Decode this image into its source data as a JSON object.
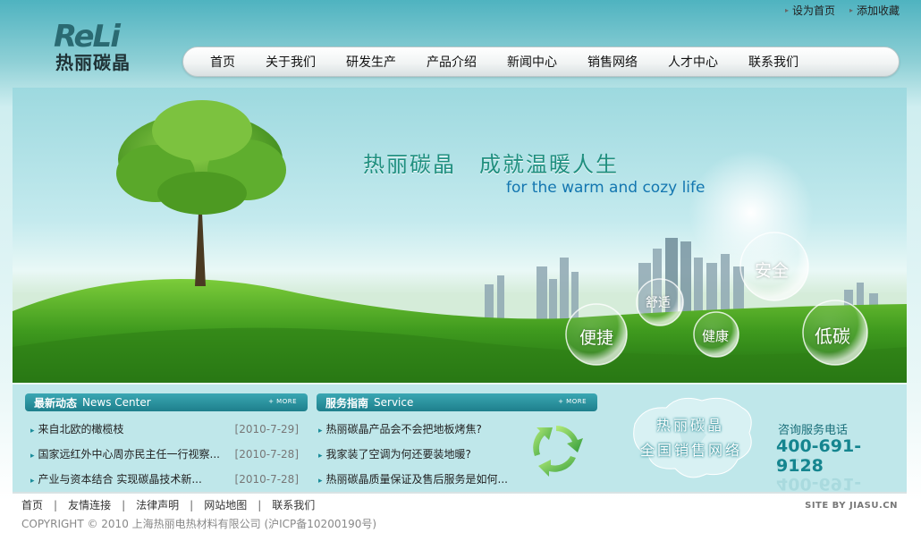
{
  "top_links": [
    {
      "label": "设为首页"
    },
    {
      "label": "添加收藏"
    }
  ],
  "logo": {
    "en": "ReLi",
    "cn": "热丽碳晶"
  },
  "nav": {
    "items": [
      {
        "label": "首页"
      },
      {
        "label": "关于我们"
      },
      {
        "label": "研发生产"
      },
      {
        "label": "产品介绍"
      },
      {
        "label": "新闻中心"
      },
      {
        "label": "销售网络"
      },
      {
        "label": "人才中心"
      },
      {
        "label": "联系我们"
      }
    ]
  },
  "banner": {
    "slogan_cn": "热丽碳晶　成就温暖人生",
    "slogan_en": "for the warm and cozy life",
    "bubbles": [
      "安全",
      "舒适",
      "便捷",
      "健康",
      "低碳"
    ]
  },
  "news": {
    "title_cn": "最新动态",
    "title_en": "News Center",
    "more": "+ MORE",
    "items": [
      {
        "title": "来自北欧的橄榄枝",
        "date": "[2010-7-29]"
      },
      {
        "title": "国家远红外中心周亦民主任一行视察...",
        "date": "[2010-7-28]"
      },
      {
        "title": "产业与资本结合 实现碳晶技术新...",
        "date": "[2010-7-28]"
      }
    ]
  },
  "service": {
    "title_cn": "服务指南",
    "title_en": "Service",
    "more": "+ MORE",
    "items": [
      {
        "title": "热丽碳晶产品会不会把地板烤焦?"
      },
      {
        "title": "我家装了空调为何还要装地暖?"
      },
      {
        "title": "热丽碳晶质量保证及售后服务是如何..."
      }
    ]
  },
  "network": {
    "line1": "热丽碳晶",
    "line2": "全国销售网络"
  },
  "hotline": {
    "label": "咨询服务电话",
    "number": "400-691-9128"
  },
  "footer": {
    "links": [
      {
        "label": "首页"
      },
      {
        "label": "友情连接"
      },
      {
        "label": "法律声明"
      },
      {
        "label": "网站地图"
      },
      {
        "label": "联系我们"
      }
    ],
    "separator": "|",
    "copyright": "COPYRIGHT © 2010 上海热丽电热材料有限公司 (沪ICP备10200190号)",
    "site_by": "SITE BY JIASU.CN"
  },
  "colors": {
    "accent": "#1e7f8c",
    "hotline": "#15858f",
    "slogan": "#1f8f7f",
    "grass": "#3f9a1e"
  }
}
